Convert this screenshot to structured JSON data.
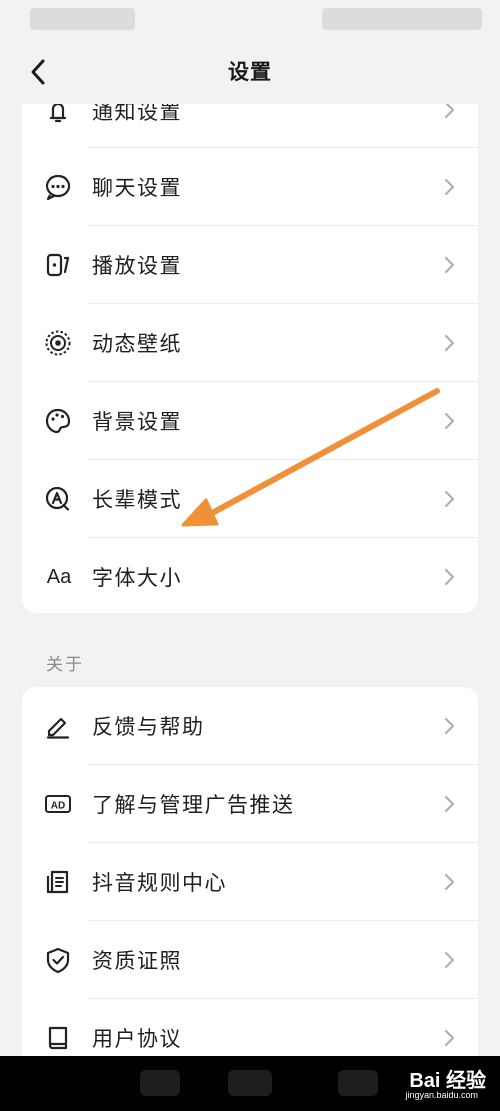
{
  "header": {
    "title": "设置"
  },
  "settings_group": {
    "items": [
      {
        "label": "通知设置",
        "icon": "bell-icon"
      },
      {
        "label": "聊天设置",
        "icon": "chat-bubble-icon"
      },
      {
        "label": "播放设置",
        "icon": "play-settings-icon"
      },
      {
        "label": "动态壁纸",
        "icon": "live-wallpaper-icon"
      },
      {
        "label": "背景设置",
        "icon": "palette-icon"
      },
      {
        "label": "长辈模式",
        "icon": "elder-mode-icon"
      },
      {
        "label": "字体大小",
        "icon": "font-size-icon",
        "glyph": "Aa"
      }
    ]
  },
  "about_section": {
    "label": "关于",
    "items": [
      {
        "label": "反馈与帮助",
        "icon": "pencil-icon"
      },
      {
        "label": "了解与管理广告推送",
        "icon": "ad-icon",
        "glyph": "AD"
      },
      {
        "label": "抖音规则中心",
        "icon": "document-list-icon"
      },
      {
        "label": "资质证照",
        "icon": "shield-check-icon"
      },
      {
        "label": "用户协议",
        "icon": "book-icon"
      }
    ]
  },
  "watermark": {
    "text": "Bai 经验",
    "sub": "jingyan.baidu.com"
  },
  "colors": {
    "background": "#f2f2f2",
    "card": "#ffffff",
    "arrow": "#f0913a",
    "chevron": "#b0b0b0"
  }
}
